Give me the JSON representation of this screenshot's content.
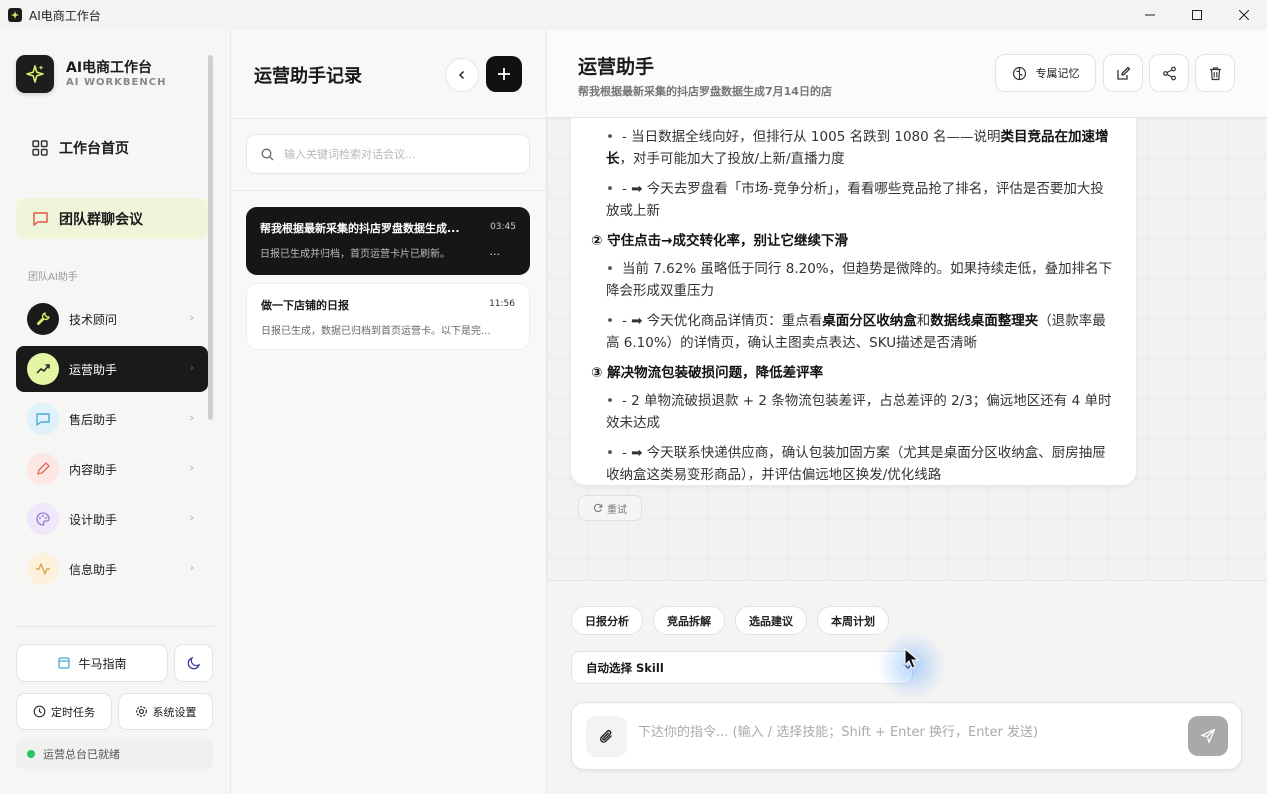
{
  "window": {
    "title": "AI电商工作台"
  },
  "brand": {
    "name": "AI电商工作台",
    "sub": "AI WORKBENCH"
  },
  "nav": {
    "home": "工作台首页",
    "group_chat": "团队群聊会议",
    "section_label": "团队AI助手"
  },
  "assistants": [
    {
      "label": "技术顾问",
      "icon": "wrench-icon",
      "color": "#1a1a1a"
    },
    {
      "label": "运营助手",
      "icon": "trend-up-icon",
      "color": "#e2f6a4"
    },
    {
      "label": "售后助手",
      "icon": "chat-bubble-icon",
      "color": "#dff1fb"
    },
    {
      "label": "内容助手",
      "icon": "pen-icon",
      "color": "#fde7e4"
    },
    {
      "label": "设计助手",
      "icon": "palette-icon",
      "color": "#efe7fa"
    },
    {
      "label": "信息助手",
      "icon": "pulse-icon",
      "color": "#fdf1dd"
    }
  ],
  "sidebar_bottom": {
    "niuma": "牛马指南",
    "scheduled": "定时任务",
    "settings": "系统设置",
    "status": "运营总台已就绪"
  },
  "middle": {
    "title": "运营助手记录",
    "search_placeholder": "输入关键词检索对话会议...",
    "records": [
      {
        "title": "帮我根据最新采集的抖店罗盘数据生成...",
        "time": "03:45",
        "sub": "日报已生成并归档，首页运营卡片已刷新。",
        "more": "..."
      },
      {
        "title": "做一下店铺的日报",
        "time": "11:56",
        "sub": "日报已生成，数据已归档到首页运营卡。以下是完..."
      }
    ]
  },
  "main": {
    "title": "运营助手",
    "subtitle": "帮我根据最新采集的抖店罗盘数据生成7月14日的店",
    "memory_label": "专属记忆",
    "message": {
      "l1_pre": "- 当日数据全线向好，但排行从 1005 名跌到 1080 名——说明",
      "l1_bold": "类目竞品在加速增长",
      "l1_post": "，对手可能加大了投放/上新/直播力度",
      "l2": "- ➡ 今天去罗盘看「市场-竞争分析」，看看哪些竞品抢了排名，评估是否要加大投放或上新",
      "h2": "② 守住点击→成交转化率，别让它继续下滑",
      "l3": "当前 7.62% 虽略低于同行 8.20%，但趋势是微降的。如果持续走低，叠加排名下降会形成双重压力",
      "l4_pre": "- ➡ 今天优化商品详情页：重点看",
      "l4_b1": "桌面分区收纳盒",
      "l4_mid": "和",
      "l4_b2": "数据线桌面整理夹",
      "l4_post": "（退款率最高 6.10%）的详情页，确认主图卖点表达、SKU描述是否清晰",
      "h3": "③ 解决物流包装破损问题，降低差评率",
      "l5": "- 2 单物流破损退款 + 2 条物流包装差评，占总差评的 2/3；偏远地区还有 4 单时效未达成",
      "l6": "- ➡ 今天联系快递供应商，确认包装加固方案（尤其是桌面分区收纳盒、厨房抽屉收纳盒这类易变形商品），并评估偏远地区换发/优化线路"
    },
    "retry": "重试",
    "chips": [
      "日报分析",
      "竞品拆解",
      "选品建议",
      "本周计划"
    ],
    "skill_select": "自动选择 Skill",
    "input_placeholder": "下达你的指令... (输入 / 选择技能；Shift + Enter 换行，Enter 发送)"
  },
  "colors": {
    "accent_dark": "#111111",
    "accent_green": "#e2f6a4",
    "status_green": "#22c55e"
  }
}
